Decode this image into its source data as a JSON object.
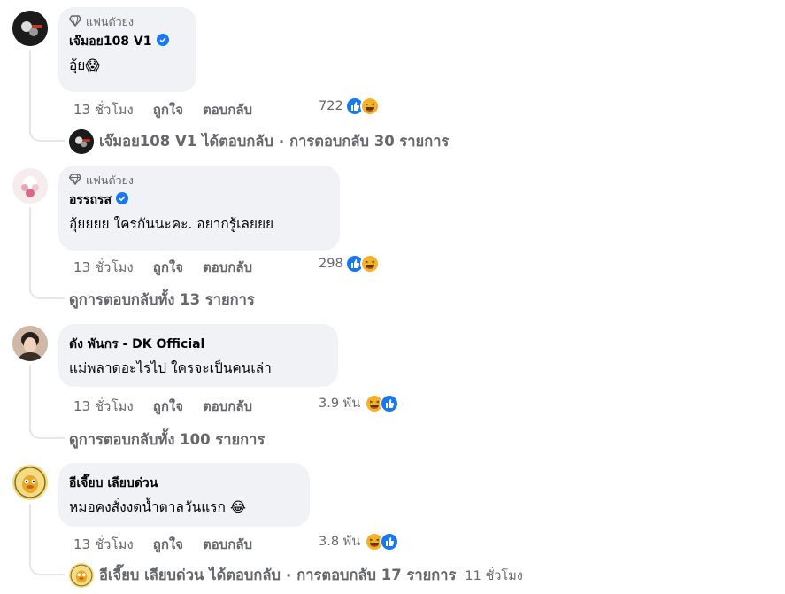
{
  "comments": [
    {
      "badge": "แฟนตัวยง",
      "author": "เจ๊มอย108 V1",
      "verified": true,
      "text": "อุ้ย😱",
      "time": "13 ชั่วโมง",
      "like": "ถูกใจ",
      "reply": "ตอบกลับ",
      "reaction_count": "722",
      "reactions": [
        "like-icon",
        "haha-icon"
      ],
      "thread": {
        "name": "เจ๊มอย108 V1",
        "replied": "ได้ตอบกลับ",
        "sep": "·",
        "summary": "การตอบกลับ 30 รายการ",
        "time": ""
      }
    },
    {
      "badge": "แฟนตัวยง",
      "author": "อรรถรส",
      "verified": true,
      "text": "อุ้ยยยย ใครกันนะคะ. อยากรู้เลยยย",
      "time": "13 ชั่วโมง",
      "like": "ถูกใจ",
      "reply": "ตอบกลับ",
      "reaction_count": "298",
      "reactions": [
        "like-icon",
        "haha-icon"
      ],
      "thread": {
        "summary": "ดูการตอบกลับทั้ง 13 รายการ"
      }
    },
    {
      "badge": "",
      "author": "ดัง พันกร - DK Official",
      "verified": false,
      "text": "แม่พลาดอะไรไป ใครจะเป็นคนเล่า",
      "time": "13 ชั่วโมง",
      "like": "ถูกใจ",
      "reply": "ตอบกลับ",
      "reaction_count": "3.9 พัน",
      "reactions": [
        "haha-icon",
        "like-icon"
      ],
      "thread": {
        "summary": "ดูการตอบกลับทั้ง 100 รายการ"
      }
    },
    {
      "badge": "",
      "author": "อีเจี๊ยบ เลียบด่วน",
      "verified": false,
      "text": "หมอคงสั่งงดน้ำตาลวันแรก 😂",
      "time": "13 ชั่วโมง",
      "like": "ถูกใจ",
      "reply": "ตอบกลับ",
      "reaction_count": "3.8 พัน",
      "reactions": [
        "haha-icon",
        "like-icon"
      ],
      "thread": {
        "name": "อีเจี๊ยบ เลียบด่วน",
        "replied": "ได้ตอบกลับ",
        "sep": "·",
        "summary": "การตอบกลับ 17 รายการ",
        "time": "11 ชั่วโมง"
      }
    }
  ],
  "colors": {
    "bubble": "#f0f2f5",
    "muted": "#65676b",
    "verified": "#1877f2",
    "like": "#1877f2",
    "haha": "#f7b125"
  }
}
